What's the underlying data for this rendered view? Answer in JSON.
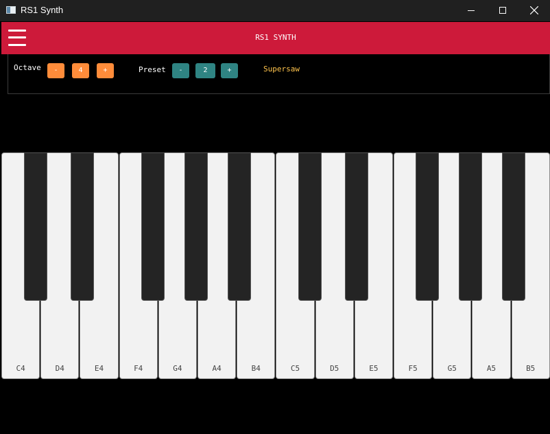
{
  "window": {
    "title": "RS1 Synth"
  },
  "header": {
    "title": "RS1 SYNTH"
  },
  "octave": {
    "label": "Octave",
    "minus": "-",
    "value": "4",
    "plus": "+"
  },
  "preset": {
    "label": "Preset",
    "minus": "-",
    "value": "2",
    "plus": "+",
    "name": "Supersaw"
  },
  "keyboard": {
    "white_keys": [
      "C4",
      "D4",
      "E4",
      "F4",
      "G4",
      "A4",
      "B4",
      "C5",
      "D5",
      "E5",
      "F5",
      "G5",
      "A5",
      "B5"
    ],
    "black_keys": [
      "C#4",
      "D#4",
      "F#4",
      "G#4",
      "A#4",
      "C#5",
      "D#5",
      "F#5",
      "G#5",
      "A#5"
    ]
  },
  "colors": {
    "header": "#cd1a3a",
    "octave_buttons": "#ff8c3a",
    "preset_buttons": "#2f8483",
    "preset_name": "#ffc44d"
  }
}
